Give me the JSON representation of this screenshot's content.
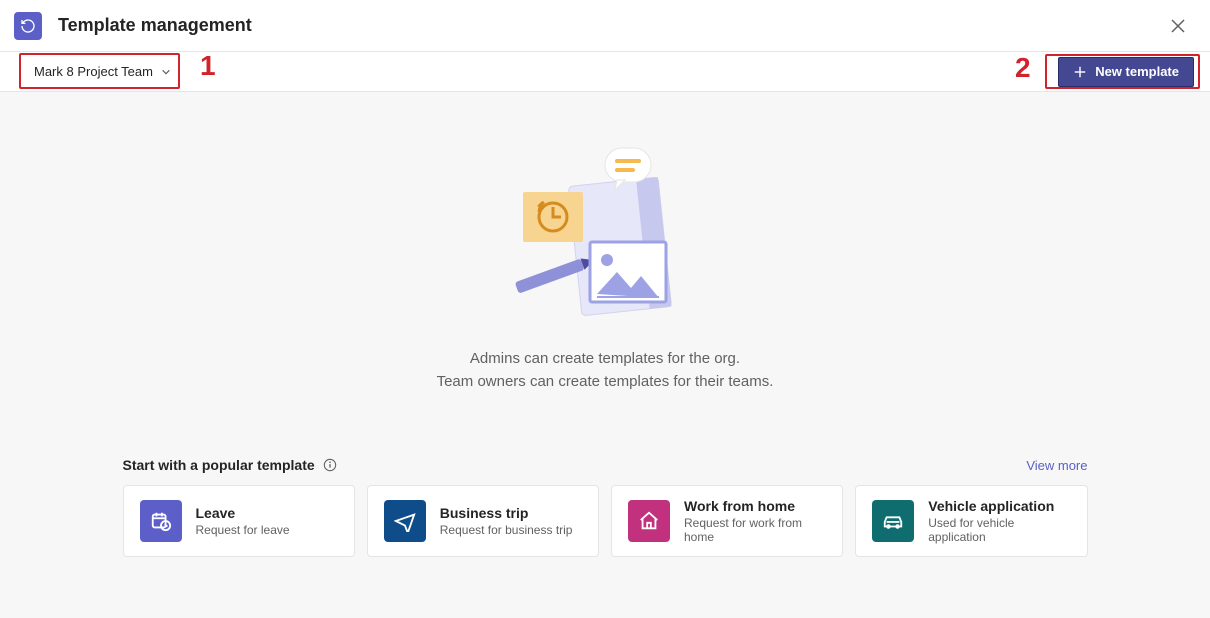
{
  "header": {
    "title": "Template management"
  },
  "toolbar": {
    "team_selected": "Mark 8 Project Team",
    "new_template_label": "New template"
  },
  "callouts": {
    "one": "1",
    "two": "2"
  },
  "empty_state": {
    "line1": "Admins can create templates for the org.",
    "line2": "Team owners can create templates for their teams."
  },
  "popular": {
    "heading": "Start with a popular template",
    "view_more": "View more",
    "cards": [
      {
        "title": "Leave",
        "subtitle": "Request for leave",
        "icon_name": "calendar-clock-icon",
        "color_class": "ic-leave"
      },
      {
        "title": "Business trip",
        "subtitle": "Request for business trip",
        "icon_name": "airplane-icon",
        "color_class": "ic-trip"
      },
      {
        "title": "Work from home",
        "subtitle": "Request for work from home",
        "icon_name": "home-icon",
        "color_class": "ic-wfh"
      },
      {
        "title": "Vehicle application",
        "subtitle": "Used for vehicle application",
        "icon_name": "car-icon",
        "color_class": "ic-vehicle"
      }
    ]
  }
}
